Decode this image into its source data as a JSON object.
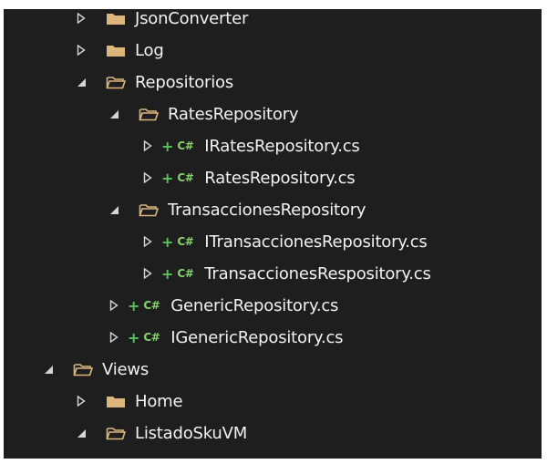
{
  "tree": {
    "items": [
      {
        "label": "JsonConverter",
        "kind": "folder",
        "state": "collapsed",
        "level": 1
      },
      {
        "label": "Log",
        "kind": "folder",
        "state": "collapsed",
        "level": 1
      },
      {
        "label": "Repositorios",
        "kind": "folder",
        "state": "expanded",
        "level": 1
      },
      {
        "label": "RatesRepository",
        "kind": "folder",
        "state": "expanded",
        "level": 2
      },
      {
        "label": "IRatesRepository.cs",
        "kind": "csharp-file",
        "state": "collapsed",
        "level": 3,
        "added_mark": "+",
        "file_badge": "C#"
      },
      {
        "label": "RatesRepository.cs",
        "kind": "csharp-file",
        "state": "collapsed",
        "level": 3,
        "added_mark": "+",
        "file_badge": "C#"
      },
      {
        "label": "TransaccionesRepository",
        "kind": "folder",
        "state": "expanded",
        "level": 2
      },
      {
        "label": "ITransaccionesRepository.cs",
        "kind": "csharp-file",
        "state": "collapsed",
        "level": 3,
        "added_mark": "+",
        "file_badge": "C#"
      },
      {
        "label": "TransaccionesRespository.cs",
        "kind": "csharp-file",
        "state": "collapsed",
        "level": 3,
        "added_mark": "+",
        "file_badge": "C#"
      },
      {
        "label": "GenericRepository.cs",
        "kind": "csharp-file",
        "state": "collapsed",
        "level": 2,
        "added_mark": "+",
        "file_badge": "C#"
      },
      {
        "label": "IGenericRepository.cs",
        "kind": "csharp-file",
        "state": "collapsed",
        "level": 2,
        "added_mark": "+",
        "file_badge": "C#"
      },
      {
        "label": "Views",
        "kind": "folder",
        "state": "expanded",
        "level": 0
      },
      {
        "label": "Home",
        "kind": "folder",
        "state": "collapsed",
        "level": 1
      },
      {
        "label": "ListadoSkuVM",
        "kind": "folder",
        "state": "expanded",
        "level": 1
      }
    ]
  },
  "colors": {
    "panel_bg": "#1e1e1e",
    "text": "#f1f1f1",
    "folder_fill": "#dcb67a",
    "added_green": "#57c35b",
    "csharp_green": "#86d36b",
    "chevron": "#d4d4d4"
  }
}
